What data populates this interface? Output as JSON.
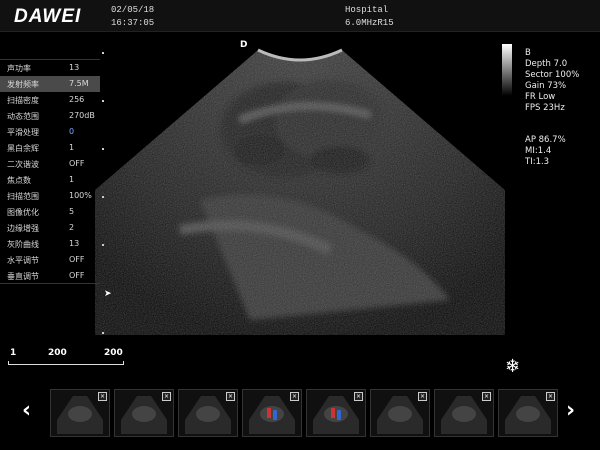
{
  "header": {
    "logo": "DAWEI",
    "date": "02/05/18",
    "time": "16:37:05",
    "hospital": "Hospital",
    "probe": "6.0MHzR15"
  },
  "params": [
    {
      "label": "声功率",
      "value": "13"
    },
    {
      "label": "发射频率",
      "value": "7.5M",
      "selected": true
    },
    {
      "label": "扫描密度",
      "value": "256"
    },
    {
      "label": "动态范围",
      "value": "270dB"
    },
    {
      "label": "平滑处理",
      "value": "0",
      "highlight": true
    },
    {
      "label": "黑白余辉",
      "value": "1"
    },
    {
      "label": "二次谐波",
      "value": "OFF"
    },
    {
      "label": "焦点数",
      "value": "1"
    },
    {
      "label": "扫描范围",
      "value": "100%"
    },
    {
      "label": "图像优化",
      "value": "5"
    },
    {
      "label": "边缘增强",
      "value": "2"
    },
    {
      "label": "灰阶曲线",
      "value": "13"
    },
    {
      "label": "水平调节",
      "value": "OFF"
    },
    {
      "label": "垂直调节",
      "value": "OFF"
    }
  ],
  "image": {
    "orientation_marker": "D"
  },
  "info": {
    "mode": "B",
    "depth": "Depth 7.0",
    "sector": "Sector 100%",
    "gain": "Gain 73%",
    "fr": "FR Low",
    "fps": "FPS 23Hz",
    "ap": "AP 86.7%",
    "mi": "MI:1.4",
    "ti": "TI:1.3"
  },
  "scale": {
    "left": "1",
    "mid": "200",
    "right": "200"
  },
  "thumbnails": {
    "count": 8,
    "close_glyph": "×",
    "prev": "‹",
    "next": "›"
  },
  "icons": {
    "freeze": "snowflake-icon"
  }
}
